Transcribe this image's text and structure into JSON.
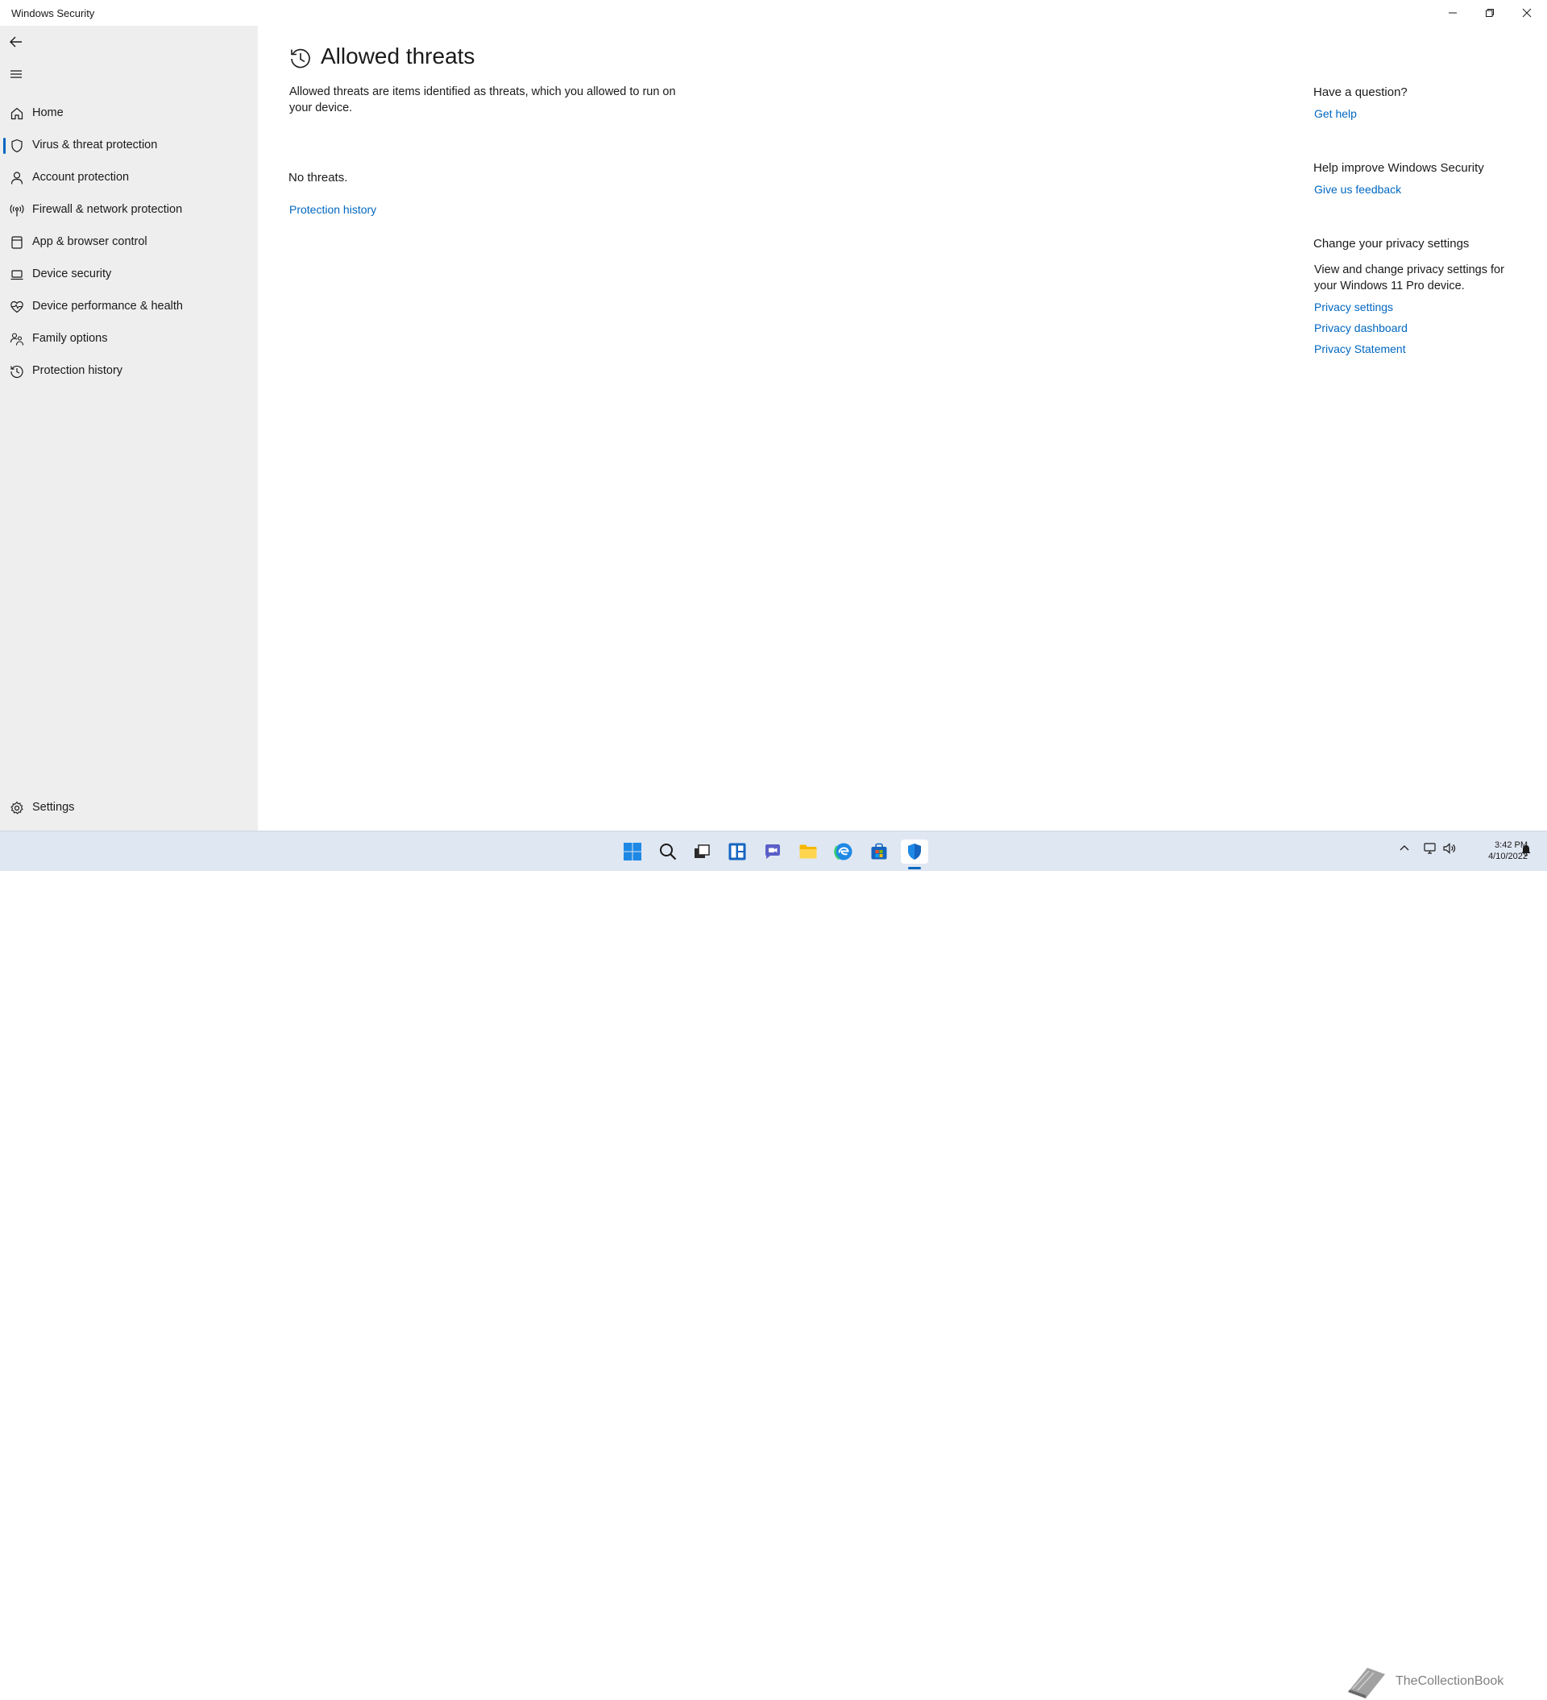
{
  "window": {
    "title": "Windows Security"
  },
  "nav": {
    "items": [
      {
        "label": "Home",
        "icon": "home-icon"
      },
      {
        "label": "Virus & threat protection",
        "icon": "shield-icon"
      },
      {
        "label": "Account protection",
        "icon": "person-icon"
      },
      {
        "label": "Firewall & network protection",
        "icon": "antenna-icon"
      },
      {
        "label": "App & browser control",
        "icon": "app-window-icon"
      },
      {
        "label": "Device security",
        "icon": "laptop-icon"
      },
      {
        "label": "Device performance & health",
        "icon": "heart-pulse-icon"
      },
      {
        "label": "Family options",
        "icon": "family-icon"
      },
      {
        "label": "Protection history",
        "icon": "history-icon"
      }
    ],
    "active_index": 1,
    "settings_label": "Settings"
  },
  "main": {
    "title": "Allowed threats",
    "description": "Allowed threats are items identified as threats, which you allowed to run on your device.",
    "no_threats": "No threats.",
    "protection_history_link": "Protection history"
  },
  "right": {
    "question_heading": "Have a question?",
    "get_help": "Get help",
    "improve_heading": "Help improve Windows Security",
    "feedback": "Give us feedback",
    "privacy_heading": "Change your privacy settings",
    "privacy_text": "View and change privacy settings for your Windows 11 Pro device.",
    "privacy_settings": "Privacy settings",
    "privacy_dashboard": "Privacy dashboard",
    "privacy_statement": "Privacy Statement"
  },
  "taskbar": {
    "time": "3:42 PM",
    "date": "4/10/2022",
    "watermark": "TheCollectionBook"
  },
  "colors": {
    "accent": "#0067c0",
    "sidebar_bg": "#eeeeee",
    "taskbar_bg": "#dfe7f2"
  }
}
